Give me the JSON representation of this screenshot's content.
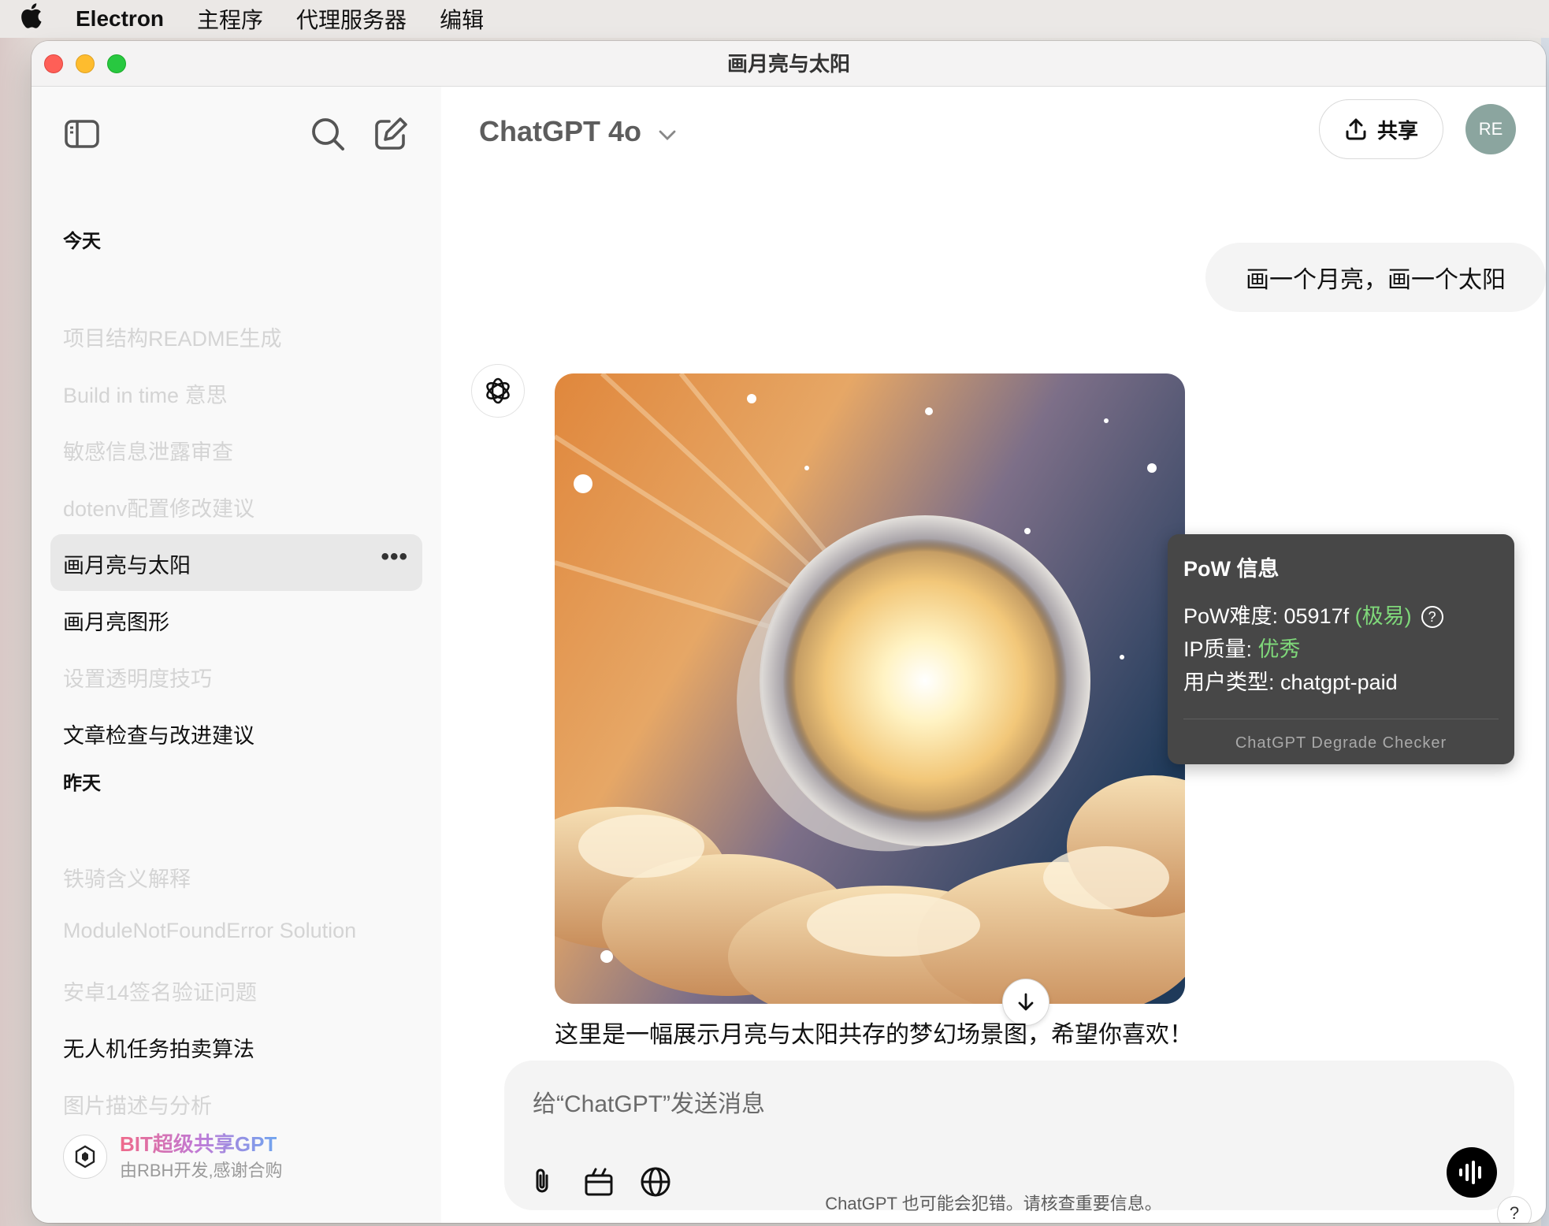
{
  "menubar": {
    "app": "Electron",
    "items": [
      "主程序",
      "代理服务器",
      "编辑"
    ]
  },
  "window": {
    "title": "画月亮与太阳"
  },
  "sidebar": {
    "groups": [
      {
        "label": "今天",
        "items": [
          {
            "label": "项目结构README生成",
            "dim": true
          },
          {
            "label": "Build in time 意思",
            "dim": true
          },
          {
            "label": "敏感信息泄露审查",
            "dim": true
          },
          {
            "label": "dotenv配置修改建议",
            "dim": true
          },
          {
            "label": "画月亮与太阳",
            "active": true
          },
          {
            "label": "画月亮图形",
            "dim": false
          },
          {
            "label": "设置透明度技巧",
            "dim": true
          },
          {
            "label": "文章检查与改进建议",
            "dim": false
          }
        ]
      },
      {
        "label": "昨天",
        "items": [
          {
            "label": "铁骑含义解释",
            "dim": true
          },
          {
            "label": "ModuleNotFoundError Solution",
            "dim": true
          },
          {
            "label": "安卓14签名验证问题",
            "dim": true
          },
          {
            "label": "无人机任务拍卖算法",
            "dim": false
          },
          {
            "label": "图片描述与分析",
            "dim": true
          }
        ]
      }
    ],
    "active_more": "•••",
    "brand": {
      "title": "BIT超级共享GPT",
      "subtitle": "由RBH开发,感谢合购"
    }
  },
  "header": {
    "model": "ChatGPT 4o",
    "share_label": "共享",
    "avatar_initials": "RE"
  },
  "conversation": {
    "user_message": "画一个月亮，画一个太阳",
    "assistant_reply": "这里是一幅展示月亮与太阳共存的梦幻场景图，希望你喜欢！"
  },
  "pow": {
    "title": "PoW 信息",
    "difficulty_label": "PoW难度: ",
    "difficulty_value": "05917f",
    "difficulty_level": "(极易)",
    "ip_label": "IP质量: ",
    "ip_value": "优秀",
    "user_type_label": "用户类型: ",
    "user_type_value": "chatgpt-paid",
    "help": "?",
    "footer": "ChatGPT Degrade Checker"
  },
  "composer": {
    "placeholder": "给“ChatGPT”发送消息"
  },
  "footer": {
    "disclaimer": "ChatGPT 也可能会犯错。请核查重要信息。",
    "help": "?"
  },
  "colors": {
    "good": "#7fd87a",
    "tooltip_bg": "#474747",
    "sidebar_bg": "#f9f9f9",
    "avatar_bg": "#8ba59f"
  },
  "icons": [
    "apple-icon",
    "sidebar-toggle-icon",
    "search-icon",
    "new-chat-icon",
    "more-icon",
    "share-icon",
    "openai-logo-icon",
    "arrow-down-icon",
    "attach-icon",
    "tools-icon",
    "globe-icon",
    "voice-icon",
    "help-icon",
    "brand-logo-icon"
  ]
}
